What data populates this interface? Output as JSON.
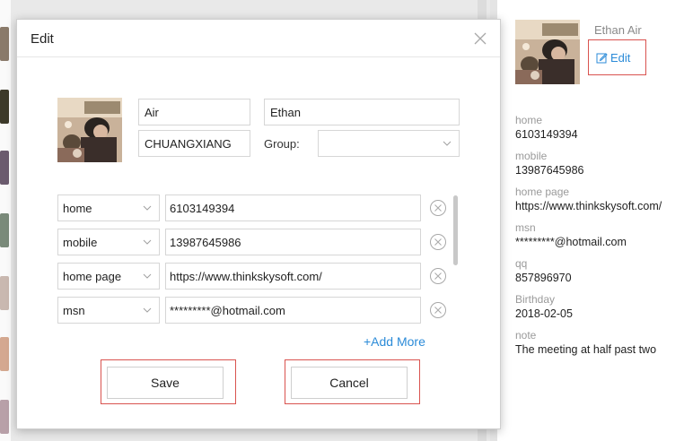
{
  "dialog": {
    "title": "Edit",
    "first_name": "Air",
    "last_name": "Ethan",
    "company": "CHUANGXIANG",
    "group_label": "Group:",
    "group_value": "",
    "fields": [
      {
        "type": "home",
        "value": "6103149394"
      },
      {
        "type": "mobile",
        "value": "13987645986"
      },
      {
        "type": "home page",
        "value": "https://www.thinkskysoft.com/"
      },
      {
        "type": "msn",
        "value": "*********@hotmail.com"
      }
    ],
    "add_more": "+Add More",
    "save": "Save",
    "cancel": "Cancel"
  },
  "detail": {
    "name": "Ethan Air",
    "edit": "Edit",
    "fields": [
      {
        "label": "home",
        "value": "6103149394"
      },
      {
        "label": "mobile",
        "value": "13987645986"
      },
      {
        "label": "home page",
        "value": "https://www.thinkskysoft.com/"
      },
      {
        "label": "msn",
        "value": "*********@hotmail.com"
      },
      {
        "label": "qq",
        "value": "857896970"
      },
      {
        "label": "Birthday",
        "value": "2018-02-05"
      },
      {
        "label": "note",
        "value": "The meeting at half past two"
      }
    ]
  },
  "icons": {
    "close": "close-icon",
    "remove": "remove-circle-icon",
    "edit": "edit-icon",
    "dropdown": "chevron-down-icon"
  },
  "colors": {
    "accent": "#2b8bd8",
    "highlight_border": "#d9534f"
  }
}
